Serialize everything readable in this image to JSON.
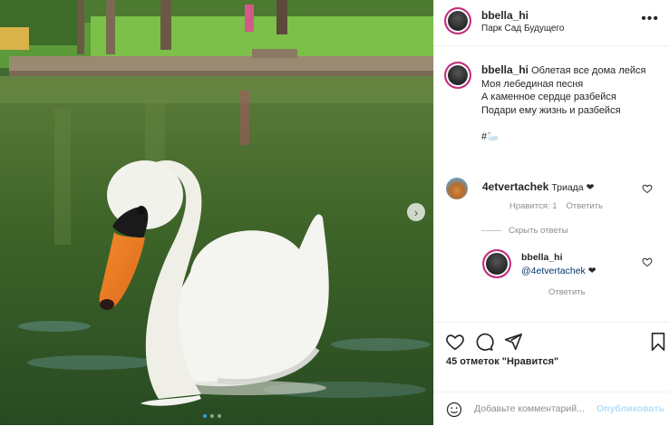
{
  "post": {
    "author": "bbella_hi",
    "location": "Парк Сад Будущего",
    "more_icon": "more-horizontal-icon",
    "caption": {
      "username": "bbella_hi",
      "lines": [
        "Облетая все дома лейся",
        "Моя лебединая песня",
        "А каменное сердце разбейся",
        "Подари ему жизнь и разбейся"
      ],
      "hashtag": "#🦢"
    },
    "carousel": {
      "current": 1,
      "total": 3,
      "next_icon": "chevron-right-icon"
    },
    "comments": [
      {
        "username": "4etvertachek",
        "text": "Триада ❤",
        "likes_label": "Нравится: 1",
        "reply_label": "Ответить"
      }
    ],
    "hide_replies_label": "Скрыть ответы",
    "reply": {
      "username": "bbella_hi",
      "mention": "@4etvertachek",
      "emoji": "❤",
      "reply_label": "Ответить"
    },
    "likes_text": "45 отметок \"Нравится\"",
    "add_comment": {
      "placeholder": "Добавьте комментарий...",
      "publish_label": "Опубликовать"
    }
  },
  "colors": {
    "accent": "#0095f6",
    "publish_disabled": "#b2dffc",
    "muted_text": "#8e8e8e",
    "story_ring": "#c72d7f"
  }
}
